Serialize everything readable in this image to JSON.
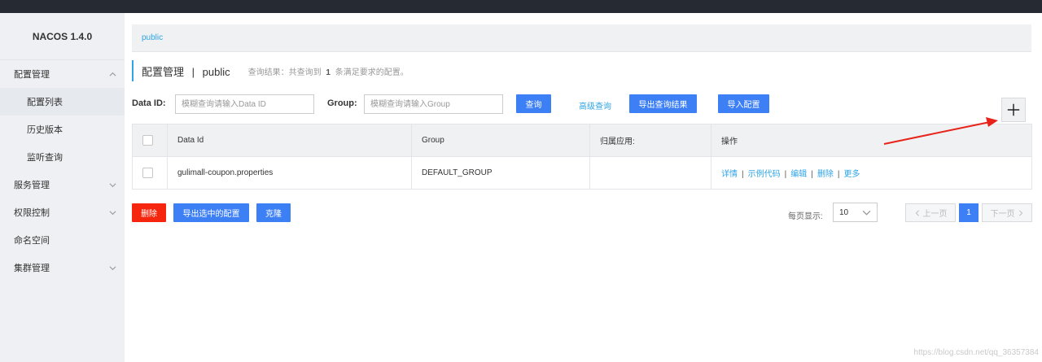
{
  "app": {
    "logo": "NACOS 1.4.0"
  },
  "sidebar": {
    "items": [
      {
        "label": "配置管理",
        "expanded": true
      },
      {
        "label": "配置列表",
        "active": true
      },
      {
        "label": "历史版本"
      },
      {
        "label": "监听查询"
      },
      {
        "label": "服务管理"
      },
      {
        "label": "权限控制"
      },
      {
        "label": "命名空间"
      },
      {
        "label": "集群管理"
      }
    ]
  },
  "breadcrumb": {
    "namespace": "public"
  },
  "header": {
    "title": "配置管理",
    "separator": "|",
    "namespace": "public",
    "result_prefix": "查询结果：共查询到",
    "result_count": "1",
    "result_suffix": "条满足要求的配置。"
  },
  "search": {
    "dataid_label": "Data ID:",
    "dataid_placeholder": "模糊查询请输入Data ID",
    "group_label": "Group:",
    "group_placeholder": "模糊查询请输入Group",
    "query_button": "查询",
    "advanced_link": "高级查询",
    "export_button": "导出查询结果",
    "import_button": "导入配置"
  },
  "table": {
    "columns": [
      "Data Id",
      "Group",
      "归属应用:",
      "操作"
    ],
    "rows": [
      {
        "data_id": "gulimall-coupon.properties",
        "group": "DEFAULT_GROUP",
        "app": "",
        "ops": [
          "详情",
          "示例代码",
          "编辑",
          "删除",
          "更多"
        ]
      }
    ]
  },
  "bulk": {
    "delete_button": "删除",
    "export_selected_button": "导出选中的配置",
    "clone_button": "克隆"
  },
  "pagination": {
    "page_size_label": "每页显示:",
    "page_size": "10",
    "prev": "上一页",
    "current": "1",
    "next": "下一页"
  },
  "watermark": "https://blog.csdn.net/qq_36357384",
  "colors": {
    "primary": "#3d7ff5",
    "danger": "#f5260d",
    "link": "#2fa4e7",
    "annotation_arrow": "#e8241a"
  }
}
